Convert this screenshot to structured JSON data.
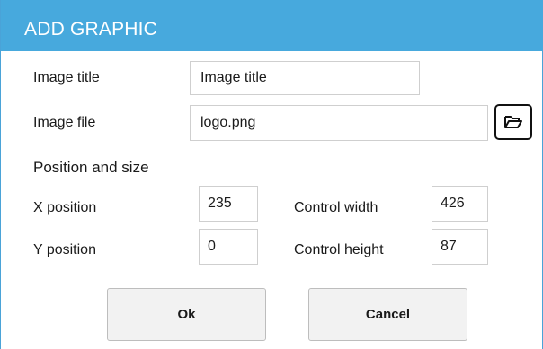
{
  "dialog": {
    "title": "ADD GRAPHIC",
    "accent_color": "#47a9dd"
  },
  "image": {
    "title_label": "Image title",
    "title_value": "Image title",
    "file_label": "Image file",
    "file_value": "logo.png",
    "browse_icon": "folder-open-icon"
  },
  "position": {
    "section_label": "Position and size",
    "x_label": "X position",
    "x_value": "235",
    "y_label": "Y position",
    "y_value": "0",
    "width_label": "Control width",
    "width_value": "426",
    "height_label": "Control height",
    "height_value": "87"
  },
  "actions": {
    "ok_label": "Ok",
    "cancel_label": "Cancel"
  }
}
